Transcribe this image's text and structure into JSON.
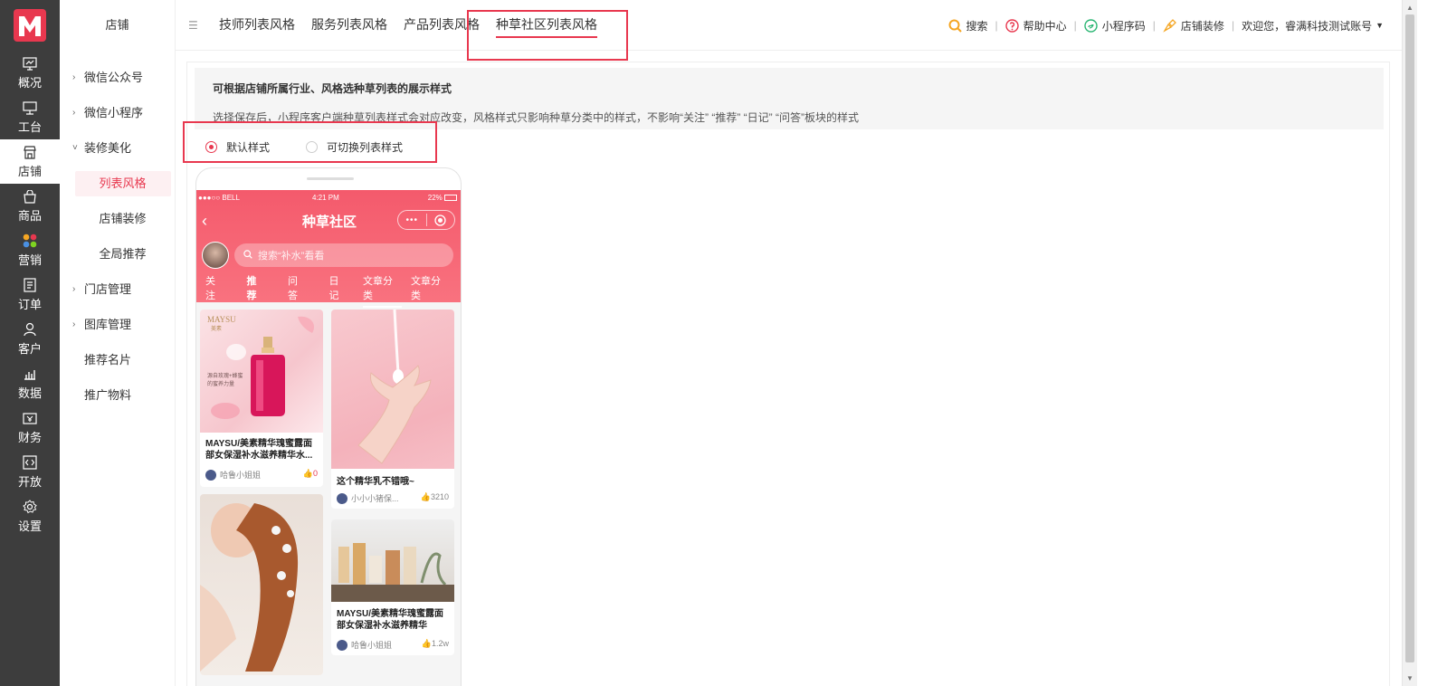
{
  "rail": {
    "items": [
      {
        "label": "概况",
        "icon": "monitor-icon"
      },
      {
        "label": "工台",
        "icon": "desktop-icon"
      },
      {
        "label": "店铺",
        "icon": "store-icon"
      },
      {
        "label": "商品",
        "icon": "bag-icon"
      },
      {
        "label": "营销",
        "icon": "colorful-dots-icon"
      },
      {
        "label": "订单",
        "icon": "order-icon"
      },
      {
        "label": "客户",
        "icon": "user-icon"
      },
      {
        "label": "数据",
        "icon": "chart-icon"
      },
      {
        "label": "财务",
        "icon": "finance-icon"
      },
      {
        "label": "开放",
        "icon": "code-icon"
      },
      {
        "label": "设置",
        "icon": "gear-icon"
      }
    ],
    "active_index": 2,
    "accent": "#e8384f"
  },
  "sidebar": {
    "title": "店铺",
    "items": [
      {
        "label": "微信公众号"
      },
      {
        "label": "微信小程序"
      },
      {
        "label": "装修美化"
      },
      {
        "label": "列表风格"
      },
      {
        "label": "店铺装修"
      },
      {
        "label": "全局推荐"
      },
      {
        "label": "门店管理"
      },
      {
        "label": "图库管理"
      },
      {
        "label": "推荐名片"
      },
      {
        "label": "推广物料"
      }
    ]
  },
  "topbar": {
    "tabs": [
      {
        "label": "技师列表风格"
      },
      {
        "label": "服务列表风格"
      },
      {
        "label": "产品列表风格"
      },
      {
        "label": "种草社区列表风格"
      }
    ],
    "search": "搜索",
    "help": "帮助中心",
    "miniapp_code": "小程序码",
    "decorate": "店铺装修",
    "welcome": "欢迎您，睿满科技测试账号"
  },
  "main": {
    "info_title": "可根据店铺所属行业、风格选种草列表的展示样式",
    "info_desc": "选择保存后，小程序客户端种草列表样式会对应改变，风格样式只影响种草分类中的样式，不影响“关注” “推荐” “日记” “问答”板块的样式",
    "options": [
      "默认样式",
      "可切换列表样式"
    ],
    "selected_option": 0
  },
  "phone": {
    "status_left": "●●●○○ BELL",
    "status_time": "4:21 PM",
    "status_right": "22%",
    "nav_title": "种草社区",
    "capsule_dots": "•••",
    "search_placeholder": "搜索“补水”看看",
    "tabs": [
      "关注",
      "推荐",
      "问答",
      "日记",
      "文章分类",
      "文章分类"
    ],
    "current_tab": 4,
    "cards": [
      {
        "title": "MAYSU/美素精华瑰蜜露面部女保湿补水滋养精华水...",
        "author": "哈鲁小姐姐",
        "likes": "0",
        "brand": "MAYSU",
        "brand_sub": "美素",
        "caption": "源自玫瑰+蜂蜜 的蜜养力量"
      },
      {
        "title": "这个精华乳不错哦~",
        "author": "小小小猪保...",
        "likes": "3210"
      },
      {
        "title": "MAYSU/美素精华瑰蜜露面部女保湿补水滋养精华",
        "author": "哈鲁小姐姐",
        "likes": "1.2w"
      }
    ]
  }
}
